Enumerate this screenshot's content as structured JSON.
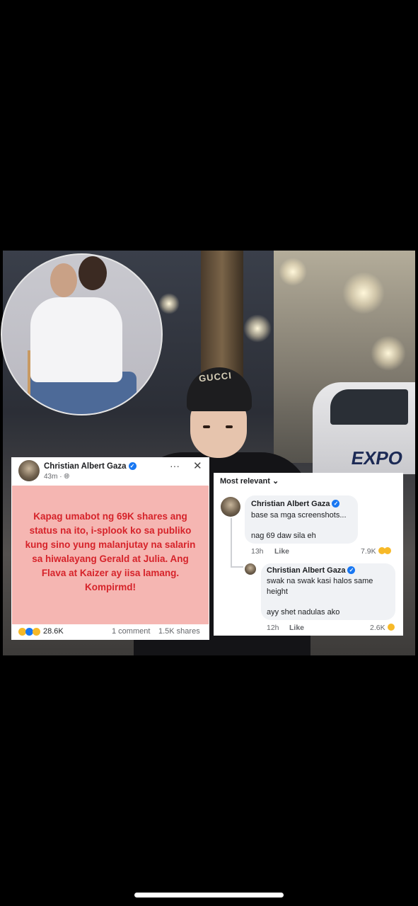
{
  "post": {
    "author": "Christian Albert Gaza",
    "time": "43m",
    "more_icon": "···",
    "close_icon": "✕",
    "text": "Kapag umabot ng 69K shares ang status na ito, i-splook ko sa publiko kung sino yung malanjutay na salarin sa hiwalayang Gerald at Julia. Ang Flava at Kaizer ay iisa lamang. Kompirmd!",
    "reactions_count": "28.6K",
    "comments_count": "1 comment",
    "shares_count": "1.5K shares"
  },
  "comments": {
    "sort_label": "Most relevant",
    "items": [
      {
        "author": "Christian Albert Gaza",
        "line1": "base sa mga screenshots...",
        "line2": "nag 69 daw sila eh",
        "time": "13h",
        "like_label": "Like",
        "reactions": "7.9K"
      },
      {
        "author": "Christian Albert Gaza",
        "line1": "swak na swak kasi halos same",
        "line1b": "height",
        "line2": "ayy shet nadulas ako",
        "time": "12h",
        "like_label": "Like",
        "reactions": "2.6K"
      }
    ]
  },
  "photo": {
    "beanie_text": "GUCCI",
    "car_text": "EXPO"
  },
  "colors": {
    "verified": "#1877f2",
    "post_text": "#d6232a",
    "post_background": "#f5b6b2"
  }
}
